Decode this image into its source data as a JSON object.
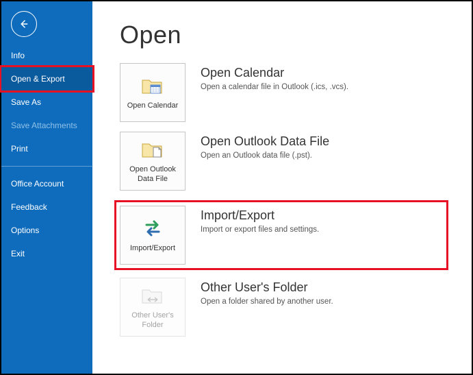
{
  "sidebar": {
    "items": [
      {
        "label": "Info",
        "state": "normal"
      },
      {
        "label": "Open & Export",
        "state": "selected"
      },
      {
        "label": "Save As",
        "state": "normal"
      },
      {
        "label": "Save Attachments",
        "state": "disabled"
      },
      {
        "label": "Print",
        "state": "normal"
      }
    ],
    "footer": [
      {
        "label": "Office Account"
      },
      {
        "label": "Feedback"
      },
      {
        "label": "Options"
      },
      {
        "label": "Exit"
      }
    ]
  },
  "main": {
    "title": "Open",
    "options": [
      {
        "tile": "Open Calendar",
        "heading": "Open Calendar",
        "desc": "Open a calendar file in Outlook (.ics, .vcs)."
      },
      {
        "tile": "Open Outlook Data File",
        "heading": "Open Outlook Data File",
        "desc": "Open an Outlook data file (.pst)."
      },
      {
        "tile": "Import/Export",
        "heading": "Import/Export",
        "desc": "Import or export files and settings."
      },
      {
        "tile": "Other User's Folder",
        "heading": "Other User's Folder",
        "desc": "Open a folder shared by another user."
      }
    ]
  }
}
